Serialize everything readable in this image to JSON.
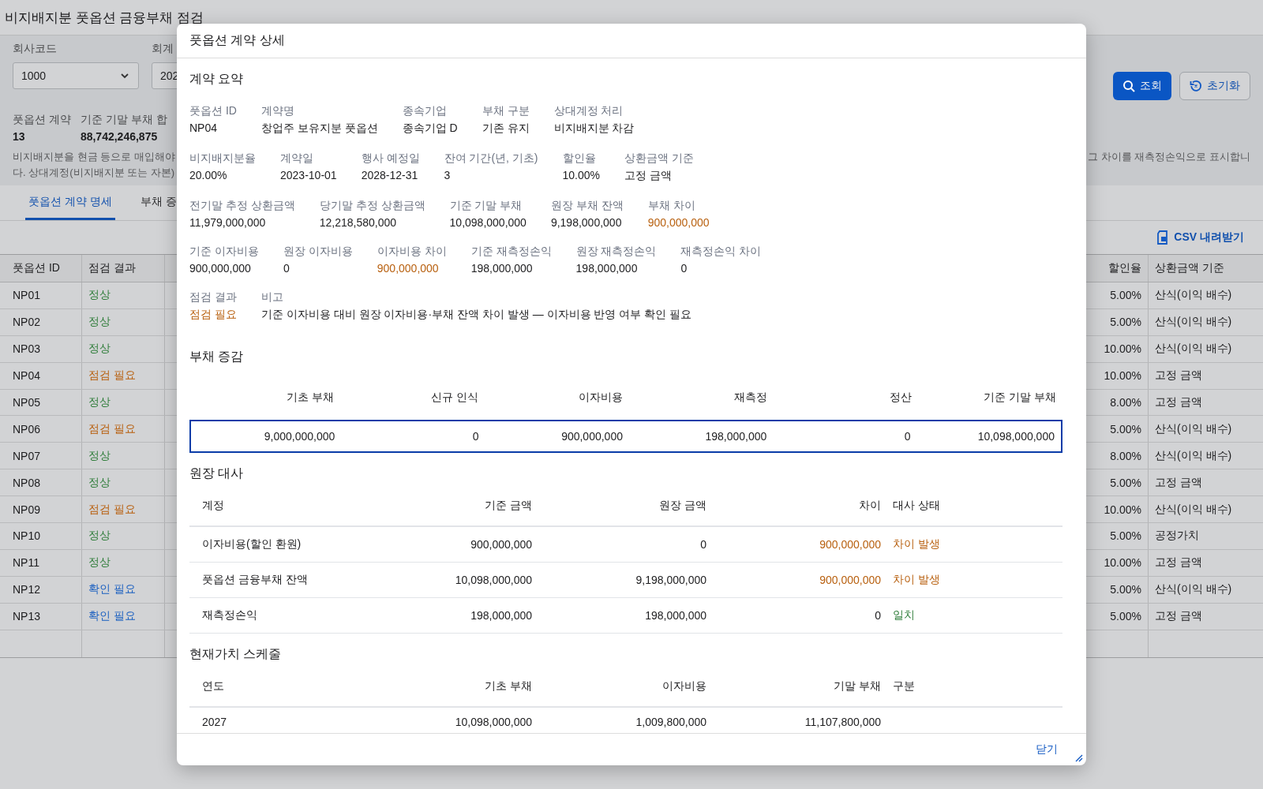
{
  "page": {
    "title": "비지배지분 풋옵션 금융부채 점검",
    "filters": [
      {
        "label": "회사코드",
        "value": "1000"
      },
      {
        "label": "회계",
        "value": "202"
      }
    ],
    "buttons": [
      {
        "label": "조회",
        "kind": "primary"
      },
      {
        "label": "초기화",
        "kind": "reset"
      }
    ],
    "summary": [
      {
        "label": "풋옵션 계약",
        "value": "13"
      },
      {
        "label": "기준 기말 부채 합",
        "value": "88,742,246,875"
      }
    ],
    "description_left": [
      "비지배지분을 현금 등으로 매입해야",
      "다. 상대계정(비지배지분 또는 자본)"
    ],
    "description_right": "그 차이를 재측정손익으로 표시합니",
    "tabs": [
      {
        "label": "풋옵션 계약 명세",
        "selected": true
      },
      {
        "label": "부채 증",
        "selected": false
      }
    ],
    "csv_button": "CSV 내려받기",
    "table": {
      "left_columns": [
        "풋옵션 ID",
        "점검 결과"
      ],
      "right_columns": [
        "할인율",
        "상환금액 기준"
      ],
      "rows": [
        {
          "id": "NP01",
          "result": "정상",
          "color": "#2f7d3a",
          "discount": "5.00%",
          "basis": "산식(이익 배수)"
        },
        {
          "id": "NP02",
          "result": "정상",
          "color": "#2f7d3a",
          "discount": "5.00%",
          "basis": "산식(이익 배수)"
        },
        {
          "id": "NP03",
          "result": "정상",
          "color": "#2f7d3a",
          "discount": "10.00%",
          "basis": "산식(이익 배수)"
        },
        {
          "id": "NP04",
          "result": "점검 필요",
          "color": "#b8600f",
          "discount": "10.00%",
          "basis": "고정 금액"
        },
        {
          "id": "NP05",
          "result": "정상",
          "color": "#2f7d3a",
          "discount": "8.00%",
          "basis": "고정 금액"
        },
        {
          "id": "NP06",
          "result": "점검 필요",
          "color": "#b8600f",
          "discount": "5.00%",
          "basis": "산식(이익 배수)"
        },
        {
          "id": "NP07",
          "result": "정상",
          "color": "#2f7d3a",
          "discount": "8.00%",
          "basis": "산식(이익 배수)"
        },
        {
          "id": "NP08",
          "result": "정상",
          "color": "#2f7d3a",
          "discount": "5.00%",
          "basis": "고정 금액"
        },
        {
          "id": "NP09",
          "result": "점검 필요",
          "color": "#b8600f",
          "discount": "10.00%",
          "basis": "산식(이익 배수)"
        },
        {
          "id": "NP10",
          "result": "정상",
          "color": "#2f7d3a",
          "discount": "5.00%",
          "basis": "공정가치"
        },
        {
          "id": "NP11",
          "result": "정상",
          "color": "#2f7d3a",
          "discount": "10.00%",
          "basis": "고정 금액"
        },
        {
          "id": "NP12",
          "result": "확인 필요",
          "color": "#1a5fc0",
          "discount": "5.00%",
          "basis": "산식(이익 배수)"
        },
        {
          "id": "NP13",
          "result": "확인 필요",
          "color": "#1a5fc0",
          "discount": "5.00%",
          "basis": "고정 금액"
        }
      ]
    }
  },
  "modal": {
    "title": "풋옵션 계약 상세",
    "summary_heading": "계약 요약",
    "field_rows": [
      [
        {
          "label": "풋옵션 ID",
          "value": "NP04"
        },
        {
          "label": "계약명",
          "value": "창업주 보유지분 풋옵션"
        },
        {
          "label": "종속기업",
          "value": "종속기업 D"
        },
        {
          "label": "부채 구분",
          "value": "기존 유지"
        },
        {
          "label": "상대계정 처리",
          "value": "비지배지분 차감"
        }
      ],
      [
        {
          "label": "비지배지분율",
          "value": "20.00%"
        },
        {
          "label": "계약일",
          "value": "2023-10-01"
        },
        {
          "label": "행사 예정일",
          "value": "2028-12-31"
        },
        {
          "label": "잔여 기간(년, 기초)",
          "value": "3"
        },
        {
          "label": "할인율",
          "value": "10.00%"
        },
        {
          "label": "상환금액 기준",
          "value": "고정 금액"
        }
      ],
      [
        {
          "label": "전기말 추정 상환금액",
          "value": "11,979,000,000"
        },
        {
          "label": "당기말 추정 상환금액",
          "value": "12,218,580,000"
        },
        {
          "label": "기준 기말 부채",
          "value": "10,098,000,000"
        },
        {
          "label": "원장 부채 잔액",
          "value": "9,198,000,000"
        },
        {
          "label": "부채 차이",
          "value": "900,000,000",
          "color": "#b8600f"
        }
      ],
      [
        {
          "label": "기준 이자비용",
          "value": "900,000,000"
        },
        {
          "label": "원장 이자비용",
          "value": "0"
        },
        {
          "label": "이자비용 차이",
          "value": "900,000,000",
          "color": "#b8600f"
        },
        {
          "label": "기준 재측정손익",
          "value": "198,000,000"
        },
        {
          "label": "원장 재측정손익",
          "value": "198,000,000"
        },
        {
          "label": "재측정손익 차이",
          "value": "0"
        }
      ],
      [
        {
          "label": "점검 결과",
          "value": "점검 필요",
          "color": "#b8600f"
        },
        {
          "label": "비고",
          "value": "기준 이자비용 대비 원장 이자비용·부채 잔액 차이 발생 — 이자비용 반영 여부 확인 필요"
        }
      ]
    ],
    "liability": {
      "heading": "부채 증감",
      "columns": [
        "기초 부채",
        "신규 인식",
        "이자비용",
        "재측정",
        "정산",
        "기준 기말 부채"
      ],
      "rows": [
        {
          "cells": [
            "9,000,000,000",
            "0",
            "900,000,000",
            "198,000,000",
            "0",
            "10,098,000,000"
          ],
          "selected": true
        }
      ]
    },
    "reconciliation": {
      "heading": "원장 대사",
      "columns": [
        "계정",
        "기준 금액",
        "원장 금액",
        "차이",
        "대사 상태"
      ],
      "rows": [
        {
          "account": "이자비용(할인 환원)",
          "base": "900,000,000",
          "ledger": "0",
          "diff": "900,000,000",
          "flagged": true,
          "status": "차이 발생",
          "color": "#b8600f"
        },
        {
          "account": "풋옵션 금융부채 잔액",
          "base": "10,098,000,000",
          "ledger": "9,198,000,000",
          "diff": "900,000,000",
          "flagged": true,
          "status": "차이 발생",
          "color": "#b8600f"
        },
        {
          "account": "재측정손익",
          "base": "198,000,000",
          "ledger": "198,000,000",
          "diff": "0",
          "flagged": false,
          "status": "일치",
          "color": "#2f7d3a"
        }
      ]
    },
    "schedule": {
      "heading": "현재가치 스케줄",
      "columns": [
        "연도",
        "기초 부채",
        "이자비용",
        "기말 부채",
        "구분"
      ],
      "rows": [
        {
          "cells": [
            "2027",
            "10,098,000,000",
            "1,009,800,000",
            "11,107,800,000"
          ]
        }
      ]
    },
    "close_button": "닫기"
  }
}
